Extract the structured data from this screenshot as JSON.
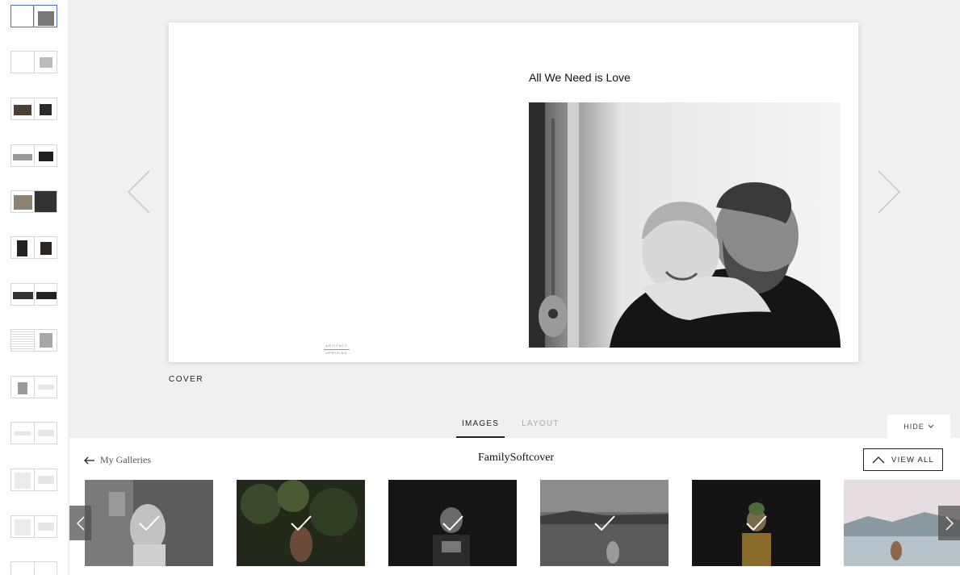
{
  "book": {
    "title": "All We Need is Love",
    "logo_line1": "ARTIFACT",
    "logo_line2": "UPRISING",
    "page_label": "COVER"
  },
  "tabs": [
    {
      "label": "IMAGES",
      "active": true
    },
    {
      "label": "LAYOUT",
      "active": false
    }
  ],
  "hide_button": {
    "label": "HIDE"
  },
  "panel": {
    "back_label": "My Galleries",
    "gallery_title": "FamilySoftcover",
    "view_all_label": "VIEW ALL"
  },
  "icons": {
    "prev": "chevron-left-icon",
    "next": "chevron-right-icon",
    "back": "arrow-left-icon",
    "check": "checkmark-icon",
    "view_all": "chevron-up-icon",
    "hide": "chevron-down-icon"
  },
  "colors": {
    "accent_selected": "#4a6ec8",
    "canvas_bg": "#f0f0f0"
  }
}
